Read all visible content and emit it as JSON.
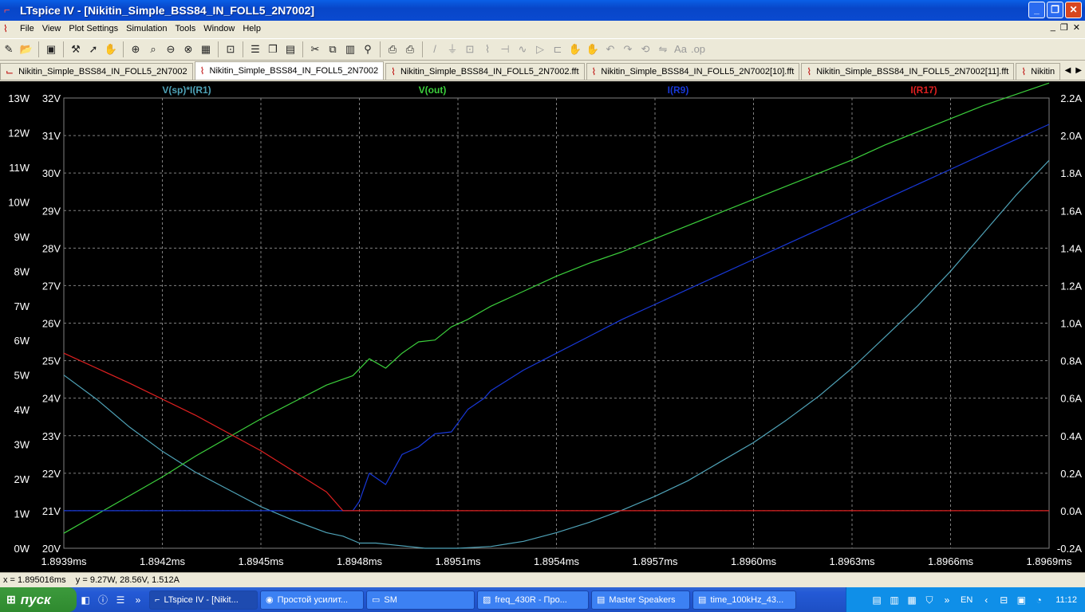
{
  "window": {
    "title": "LTspice IV - [Nikitin_Simple_BSS84_IN_FOLL5_2N7002]"
  },
  "menu": [
    "File",
    "View",
    "Plot Settings",
    "Simulation",
    "Tools",
    "Window",
    "Help"
  ],
  "toolbar_icons": [
    "new-schematic-icon",
    "open-icon",
    "save-icon",
    "control-panel-icon",
    "run-icon",
    "halt-icon",
    "zoom-in-icon",
    "zoom-area-icon",
    "zoom-out-icon",
    "zoom-fit-icon",
    "autorange-icon",
    "measure-icon",
    "tile-horizontal-icon",
    "cascade-icon",
    "tile-icon",
    "cut-icon",
    "copy-icon",
    "paste-icon",
    "find-icon",
    "print-setup-icon",
    "print-icon",
    "wire-icon",
    "ground-icon",
    "label-icon",
    "resistor-icon",
    "capacitor-icon",
    "inductor-icon",
    "diode-icon",
    "component-icon",
    "move-icon",
    "drag-icon",
    "undo-icon",
    "redo-icon",
    "rotate-icon",
    "mirror-icon",
    "text-icon",
    "spice-directive-icon"
  ],
  "tabs": [
    {
      "label": "Nikitin_Simple_BSS84_IN_FOLL5_2N7002",
      "icon": "schematic-icon"
    },
    {
      "label": "Nikitin_Simple_BSS84_IN_FOLL5_2N7002",
      "icon": "waveform-icon",
      "active": true
    },
    {
      "label": "Nikitin_Simple_BSS84_IN_FOLL5_2N7002.fft",
      "icon": "waveform-icon"
    },
    {
      "label": "Nikitin_Simple_BSS84_IN_FOLL5_2N7002[10].fft",
      "icon": "waveform-icon"
    },
    {
      "label": "Nikitin_Simple_BSS84_IN_FOLL5_2N7002[11].fft",
      "icon": "waveform-icon"
    },
    {
      "label": "Nikitin",
      "icon": "waveform-icon"
    }
  ],
  "status": {
    "text": "x = 1.895016ms    y = 9.27W, 28.56V, 1.512A"
  },
  "colors": {
    "grid": "#808080",
    "axis_text": "#ffffff",
    "vsp_trace": "#4fa3b8",
    "vout_trace": "#3cd03c",
    "ir9_trace": "#1838d8",
    "ir17_trace": "#e02020"
  },
  "chart_data": {
    "type": "line",
    "xlabel": "",
    "x_ticks": [
      "1.8939ms",
      "1.8942ms",
      "1.8945ms",
      "1.8948ms",
      "1.8951ms",
      "1.8954ms",
      "1.8957ms",
      "1.8960ms",
      "1.8963ms",
      "1.8966ms",
      "1.8969ms"
    ],
    "xlim": [
      1.8939,
      1.8969
    ],
    "axes": {
      "power": {
        "ticks": [
          "0W",
          "1W",
          "2W",
          "3W",
          "4W",
          "5W",
          "6W",
          "7W",
          "8W",
          "9W",
          "10W",
          "11W",
          "12W",
          "13W"
        ],
        "ylim": [
          0,
          13
        ]
      },
      "voltage": {
        "ticks": [
          "20V",
          "21V",
          "22V",
          "23V",
          "24V",
          "25V",
          "26V",
          "27V",
          "28V",
          "29V",
          "30V",
          "31V",
          "32V"
        ],
        "ylim": [
          20,
          32
        ]
      },
      "current": {
        "ticks": [
          "-0.2A",
          "0.0A",
          "0.2A",
          "0.4A",
          "0.6A",
          "0.8A",
          "1.0A",
          "1.2A",
          "1.4A",
          "1.6A",
          "1.8A",
          "2.0A",
          "2.2A"
        ],
        "ylim": [
          -0.2,
          2.2
        ]
      }
    },
    "series": [
      {
        "name": "V(sp)*I(R1)",
        "axis": "power",
        "color": "#4fa3b8",
        "x": [
          1.8939,
          1.894,
          1.8941,
          1.8942,
          1.8943,
          1.8944,
          1.8945,
          1.8946,
          1.8947,
          1.89475,
          1.8948,
          1.89485,
          1.8949,
          1.89495,
          1.895,
          1.8951,
          1.8952,
          1.8953,
          1.8954,
          1.8955,
          1.8956,
          1.8957,
          1.8958,
          1.8959,
          1.896,
          1.8961,
          1.8962,
          1.8963,
          1.8964,
          1.8965,
          1.8966,
          1.8967,
          1.8968,
          1.8969
        ],
        "y": [
          5.0,
          4.3,
          3.5,
          2.8,
          2.2,
          1.7,
          1.2,
          0.8,
          0.45,
          0.35,
          0.15,
          0.15,
          0.1,
          0.05,
          0.0,
          0.0,
          0.05,
          0.2,
          0.45,
          0.75,
          1.1,
          1.5,
          1.95,
          2.5,
          3.05,
          3.7,
          4.4,
          5.2,
          6.1,
          7.0,
          8.0,
          9.1,
          10.2,
          11.2
        ]
      },
      {
        "name": "V(out)",
        "axis": "voltage",
        "color": "#3cd03c",
        "x": [
          1.8939,
          1.894,
          1.8941,
          1.8942,
          1.8943,
          1.8944,
          1.8945,
          1.8946,
          1.8947,
          1.89478,
          1.89483,
          1.89488,
          1.89493,
          1.89498,
          1.89503,
          1.89508,
          1.89513,
          1.89518,
          1.8952,
          1.8953,
          1.8954,
          1.8955,
          1.8956,
          1.8957,
          1.8958,
          1.8959,
          1.896,
          1.8961,
          1.8962,
          1.8963,
          1.8964,
          1.8965,
          1.8966,
          1.8967,
          1.8968,
          1.8969
        ],
        "y": [
          20.4,
          20.9,
          21.4,
          21.9,
          22.45,
          22.95,
          23.45,
          23.9,
          24.35,
          24.6,
          25.05,
          24.8,
          25.2,
          25.5,
          25.55,
          25.9,
          26.1,
          26.35,
          26.45,
          26.85,
          27.25,
          27.6,
          27.9,
          28.25,
          28.6,
          28.95,
          29.3,
          29.65,
          30.0,
          30.35,
          30.75,
          31.1,
          31.45,
          31.8,
          32.1,
          32.4
        ]
      },
      {
        "name": "I(R9)",
        "axis": "current",
        "color": "#1838d8",
        "x": [
          1.8939,
          1.8944,
          1.89478,
          1.8948,
          1.89483,
          1.89488,
          1.89493,
          1.89498,
          1.89503,
          1.89508,
          1.89513,
          1.89518,
          1.8952,
          1.8953,
          1.8954,
          1.8955,
          1.8956,
          1.8957,
          1.8958,
          1.8959,
          1.896,
          1.8961,
          1.8962,
          1.8963,
          1.8964,
          1.8965,
          1.8966,
          1.8967,
          1.8968,
          1.8969
        ],
        "y": [
          0.0,
          0.0,
          0.0,
          0.05,
          0.2,
          0.14,
          0.3,
          0.34,
          0.41,
          0.42,
          0.54,
          0.6,
          0.64,
          0.75,
          0.84,
          0.93,
          1.02,
          1.1,
          1.18,
          1.26,
          1.34,
          1.42,
          1.5,
          1.58,
          1.66,
          1.74,
          1.82,
          1.9,
          1.98,
          2.06
        ]
      },
      {
        "name": "I(R17)",
        "axis": "current",
        "color": "#e02020",
        "x": [
          1.8939,
          1.8941,
          1.8943,
          1.8945,
          1.8947,
          1.89475,
          1.8969
        ],
        "y": [
          0.84,
          0.68,
          0.51,
          0.32,
          0.1,
          0.0,
          0.0
        ]
      }
    ]
  },
  "taskbar": {
    "start": "пуск",
    "tasks": [
      {
        "label": "LTspice IV - [Nikit...",
        "icon": "ltspice-icon",
        "active": true
      },
      {
        "label": "Простой усилит...",
        "icon": "firefox-icon"
      },
      {
        "label": "SM",
        "icon": "folder-icon"
      },
      {
        "label": "freq_430R - Про...",
        "icon": "image-viewer-icon"
      },
      {
        "label": "Master Speakers",
        "icon": "app-icon"
      },
      {
        "label": "time_100kHz_43...",
        "icon": "app-icon"
      }
    ],
    "lang": "EN",
    "clock": "11:12"
  }
}
